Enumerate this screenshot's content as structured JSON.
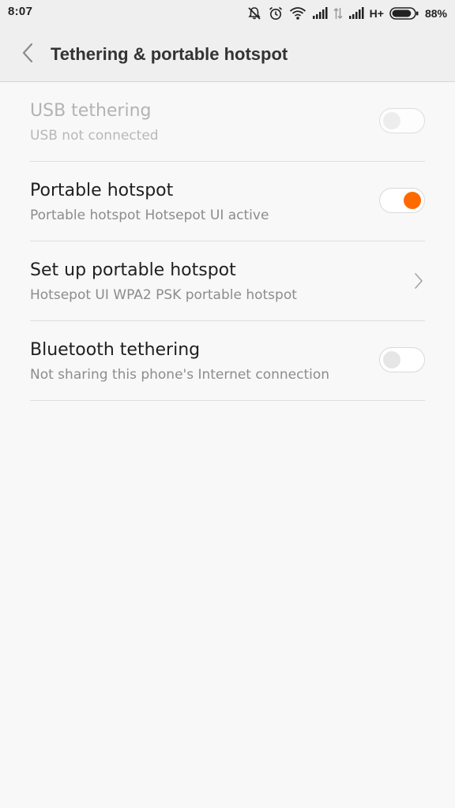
{
  "status_bar": {
    "time": "8:07",
    "network_type": "H+",
    "battery_percent": "88%",
    "battery_level": 0.88,
    "icons": [
      "notifications-muted-icon",
      "alarm-icon",
      "wifi-icon",
      "signal-icon",
      "data-transfer-icon",
      "signal-icon",
      "battery-icon"
    ]
  },
  "header": {
    "title": "Tethering & portable hotspot",
    "back_icon": "chevron-left-icon"
  },
  "settings": [
    {
      "title": "USB tethering",
      "subtitle": "USB not connected",
      "control": "toggle",
      "state": "off",
      "enabled": false
    },
    {
      "title": "Portable hotspot",
      "subtitle": "Portable hotspot Hotsepot UI active",
      "control": "toggle",
      "state": "on",
      "enabled": true
    },
    {
      "title": "Set up portable hotspot",
      "subtitle": "Hotsepot UI WPA2 PSK portable hotspot",
      "control": "chevron",
      "enabled": true
    },
    {
      "title": "Bluetooth tethering",
      "subtitle": "Not sharing this phone's Internet connection",
      "control": "toggle",
      "state": "off",
      "enabled": true
    }
  ],
  "colors": {
    "accent": "#ff6a00",
    "background": "#f8f8f8",
    "header_background": "#efefef"
  }
}
